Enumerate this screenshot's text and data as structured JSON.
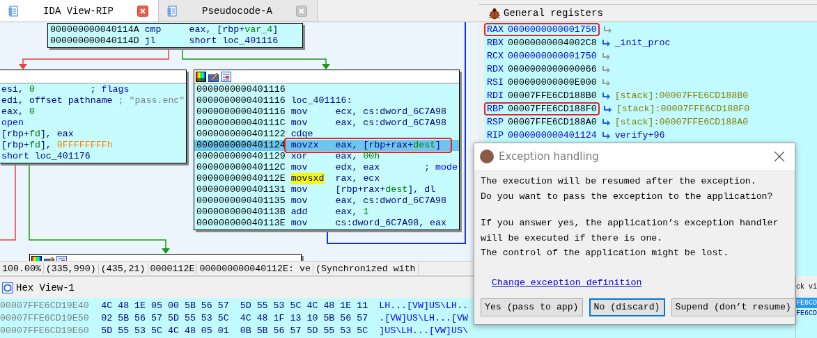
{
  "tabs": [
    {
      "label": "IDA View-RIP",
      "selected": true
    },
    {
      "label": "Pseudocode-A",
      "selected": false
    }
  ],
  "graph": {
    "nodes": [
      {
        "kind": "block",
        "lines": [
          {
            "kind": "insn",
            "selected": false,
            "annotated": false,
            "highlight": false,
            "address": "000000000040114A",
            "mnemonic": "cmp",
            "segments": [
              {
                "text": "eax, [rbp+",
                "kind": "plain"
              },
              {
                "text": "var_4",
                "kind": "name"
              },
              {
                "text": "]",
                "kind": "plain"
              }
            ]
          },
          {
            "kind": "insn",
            "selected": false,
            "annotated": false,
            "highlight": false,
            "address": "000000000040114D",
            "mnemonic": "jl",
            "segments": [
              {
                "text": "short loc_401116",
                "kind": "plain"
              }
            ]
          }
        ]
      },
      {
        "kind": "cut-block",
        "lines": [
          {
            "kind": "operands",
            "selected": false,
            "annotated": false,
            "segments": [
              {
                "text": "esi, ",
                "kind": "plain"
              },
              {
                "text": "0",
                "kind": "number"
              },
              {
                "text": "; flags",
                "kind": "comment"
              }
            ]
          },
          {
            "kind": "operands",
            "selected": false,
            "annotated": false,
            "segments": [
              {
                "text": "edi, offset pathname",
                "kind": "plain"
              },
              {
                "text": "; \"pass.enc\"",
                "kind": "string"
              }
            ]
          },
          {
            "kind": "operands",
            "selected": false,
            "annotated": false,
            "segments": [
              {
                "text": "eax, ",
                "kind": "plain"
              },
              {
                "text": "0",
                "kind": "number"
              }
            ]
          },
          {
            "kind": "operands",
            "selected": false,
            "annotated": false,
            "segments": [
              {
                "text": "open",
                "kind": "func"
              }
            ]
          },
          {
            "kind": "operands",
            "selected": false,
            "annotated": false,
            "segments": [
              {
                "text": "[rbp+",
                "kind": "plain"
              },
              {
                "text": "fd",
                "kind": "name"
              },
              {
                "text": "], eax",
                "kind": "plain"
              }
            ]
          },
          {
            "kind": "operands",
            "selected": false,
            "annotated": false,
            "segments": [
              {
                "text": "[rbp+",
                "kind": "plain"
              },
              {
                "text": "fd",
                "kind": "name"
              },
              {
                "text": "], ",
                "kind": "plain"
              },
              {
                "text": "0FFFFFFFFh",
                "kind": "hex"
              }
            ]
          },
          {
            "kind": "operands",
            "selected": false,
            "annotated": false,
            "segments": [
              {
                "text": "short loc_401176",
                "kind": "plain"
              }
            ]
          }
        ]
      },
      {
        "kind": "block-with-toolbar",
        "lines": [
          {
            "kind": "empty",
            "selected": false,
            "annotated": false,
            "address": "0000000000401116"
          },
          {
            "kind": "label",
            "selected": false,
            "annotated": false,
            "address": "0000000000401116",
            "label": "loc_401116:"
          },
          {
            "kind": "insn",
            "selected": false,
            "annotated": false,
            "highlight": false,
            "address": "0000000000401116",
            "mnemonic": "mov",
            "segments": [
              {
                "text": "ecx, cs:dword_6C7A98",
                "kind": "plain"
              }
            ]
          },
          {
            "kind": "insn",
            "selected": false,
            "annotated": false,
            "highlight": false,
            "address": "000000000040111C",
            "mnemonic": "mov",
            "segments": [
              {
                "text": "eax, cs:dword_6C7A98",
                "kind": "plain"
              }
            ]
          },
          {
            "kind": "insn",
            "selected": false,
            "annotated": false,
            "highlight": false,
            "address": "0000000000401122",
            "mnemonic": "cdqe"
          },
          {
            "kind": "insn",
            "selected": true,
            "annotated": true,
            "highlight": false,
            "address": "0000000000401124",
            "mnemonic": "movzx",
            "segments": [
              {
                "text": "eax, [rbp+rax+",
                "kind": "plain"
              },
              {
                "text": "dest",
                "kind": "name"
              },
              {
                "text": "]",
                "kind": "plain"
              }
            ]
          },
          {
            "kind": "insn",
            "selected": false,
            "annotated": false,
            "highlight": false,
            "address": "0000000000401129",
            "mnemonic": "xor",
            "segments": [
              {
                "text": "eax, ",
                "kind": "plain"
              },
              {
                "text": "00h",
                "kind": "number"
              }
            ]
          },
          {
            "kind": "insn",
            "selected": false,
            "annotated": false,
            "highlight": false,
            "address": "000000000040112C",
            "mnemonic": "mov",
            "segments": [
              {
                "text": "edx, eax",
                "kind": "plain"
              },
              {
                "text": "; mode",
                "kind": "comment"
              }
            ]
          },
          {
            "kind": "insn",
            "selected": false,
            "annotated": false,
            "highlight": true,
            "address": "000000000040112E",
            "mnemonic": "movsxd",
            "segments": [
              {
                "text": "rax, ecx",
                "kind": "plain"
              }
            ]
          },
          {
            "kind": "insn",
            "selected": false,
            "annotated": false,
            "highlight": false,
            "address": "0000000000401131",
            "mnemonic": "mov",
            "segments": [
              {
                "text": "[rbp+rax+",
                "kind": "plain"
              },
              {
                "text": "dest",
                "kind": "name"
              },
              {
                "text": "], dl",
                "kind": "plain"
              }
            ]
          },
          {
            "kind": "insn",
            "selected": false,
            "annotated": false,
            "highlight": false,
            "address": "0000000000401135",
            "mnemonic": "mov",
            "segments": [
              {
                "text": "eax, cs:dword_6C7A98",
                "kind": "plain"
              }
            ]
          },
          {
            "kind": "insn",
            "selected": false,
            "annotated": false,
            "highlight": false,
            "address": "000000000040113B",
            "mnemonic": "add",
            "segments": [
              {
                "text": "eax, ",
                "kind": "plain"
              },
              {
                "text": "1",
                "kind": "number"
              }
            ]
          },
          {
            "kind": "insn",
            "selected": false,
            "annotated": false,
            "highlight": false,
            "address": "000000000040113E",
            "mnemonic": "mov",
            "segments": [
              {
                "text": "cs:dword_6C7A98, eax",
                "kind": "plain"
              }
            ]
          }
        ]
      },
      {
        "kind": "block-with-toolbar"
      }
    ]
  },
  "status_bar": [
    "100.00%",
    "(335,990)",
    "(435,21)",
    "0000112E",
    "000000000040112E: ve",
    "(Synchronized with"
  ],
  "hex_view": {
    "title": "Hex View-1",
    "rows": [
      {
        "address": "00007FFE6CD19E40",
        "bytes_1": "4C 48 1E 05 00 5B 56 57",
        "bytes_2": "5D 55 53 5C 4C 48 1E 11",
        "text": "LH...[VW]US\\LH.."
      },
      {
        "address": "00007FFE6CD19E50",
        "bytes_1": "02 5B 56 57 5D 55 53 5C",
        "bytes_2": "4C 48 1F 13 10 5B 56 57",
        "text": ".[VW]US\\LH...[VW"
      },
      {
        "address": "00007FFE6CD19E60",
        "bytes_1": "5D 55 53 5C 4C 48 05 01",
        "bytes_2": "0B 5B 56 57 5D 55 53 5C",
        "text": "]US\\LH...[VW]US\\"
      }
    ]
  },
  "registers": {
    "title": "General registers",
    "rows": [
      {
        "name": "RAX",
        "value": "0000000000001750",
        "changed": true,
        "annotated": true,
        "kind": "none"
      },
      {
        "name": "RBX",
        "value": "00000000004002C8",
        "changed": false,
        "annotated": false,
        "kind": "symbol",
        "target": "_init_proc"
      },
      {
        "name": "RCX",
        "value": "0000000000001750",
        "changed": true,
        "annotated": false,
        "kind": "none"
      },
      {
        "name": "RDX",
        "value": "0000000000000066",
        "changed": false,
        "annotated": false,
        "kind": "none"
      },
      {
        "name": "RSI",
        "value": "000000000000E000",
        "changed": false,
        "annotated": false,
        "kind": "none"
      },
      {
        "name": "RDI",
        "value": "00007FFE6CD188B0",
        "changed": false,
        "annotated": false,
        "kind": "stack",
        "target": "[stack]:00007FFE6CD188B0"
      },
      {
        "name": "RBP",
        "value": "00007FFE6CD188F0",
        "changed": false,
        "annotated": true,
        "kind": "stack",
        "target": "[stack]:00007FFE6CD188F0"
      },
      {
        "name": "RSP",
        "value": "00007FFE6CD188A0",
        "changed": false,
        "annotated": false,
        "kind": "stack",
        "target": "[stack]:00007FFE6CD188A0"
      },
      {
        "name": "RIP",
        "value": "0000000000401124",
        "changed": true,
        "annotated": false,
        "kind": "symbol",
        "target": "verify+96"
      }
    ]
  },
  "stack_view": {
    "title": "ck vi",
    "rows": [
      {
        "text": "FE6CD",
        "selected": true
      },
      {
        "text": "FE6CD",
        "selected": false
      }
    ]
  },
  "dialog": {
    "title": "Exception handling",
    "paragraphs": [
      [
        "The execution will be resumed after the exception.",
        "Do you want to pass the exception to the application?"
      ],
      [
        "If you answer yes, the application’s exception handler",
        "will be executed if there is one.",
        "The control of the application might be lost."
      ]
    ],
    "link": "Change exception definition",
    "buttons": [
      {
        "label": "Yes (pass to app)",
        "focused": false
      },
      {
        "label": "No (discard)",
        "focused": true
      },
      {
        "label": "Supend (don’t resume)",
        "focused": false
      }
    ]
  }
}
